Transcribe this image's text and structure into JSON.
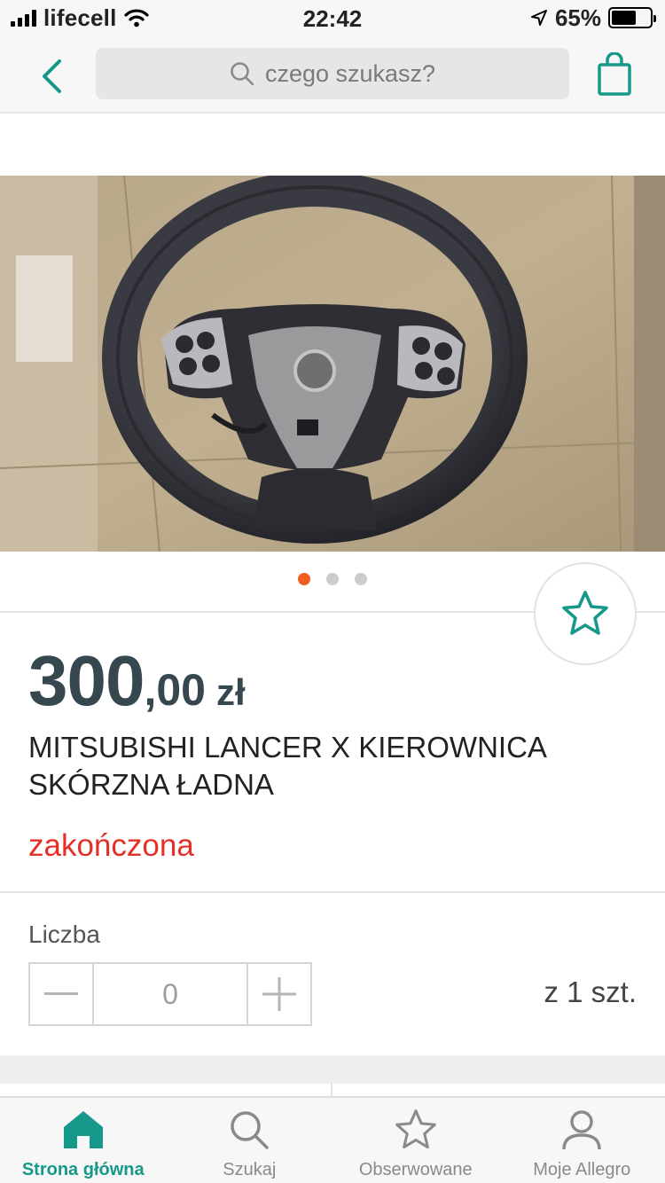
{
  "status_bar": {
    "carrier": "lifecell",
    "time": "22:42",
    "battery_percent": "65%",
    "battery_level": 0.65
  },
  "header": {
    "back_icon": "chevron-left-icon",
    "search_placeholder": "czego szukasz?",
    "search_icon": "search-icon",
    "cart_icon": "shopping-bag-icon"
  },
  "gallery": {
    "image": "steering-wheel-photo",
    "image_count": 3,
    "active_index": 0
  },
  "product": {
    "price_int": "300",
    "price_dec": ",00",
    "currency": "zł",
    "title": "MITSUBISHI LANCER X KIEROWNICA SKÓRZNA ŁADNA",
    "status": "zakończona",
    "favorite_icon": "star-icon"
  },
  "quantity": {
    "label": "Liczba",
    "value": "0",
    "available": "z 1 szt."
  },
  "tabbar": {
    "items": [
      {
        "label": "Strona główna",
        "icon": "home-icon",
        "active": true
      },
      {
        "label": "Szukaj",
        "icon": "search-icon"
      },
      {
        "label": "Obserwowane",
        "icon": "star-icon"
      },
      {
        "label": "Moje Allegro",
        "icon": "user-icon"
      }
    ]
  },
  "colors": {
    "accent": "#16998a",
    "price": "#37474f",
    "status_ended": "#e5302a",
    "dot_active": "#f25d22"
  }
}
